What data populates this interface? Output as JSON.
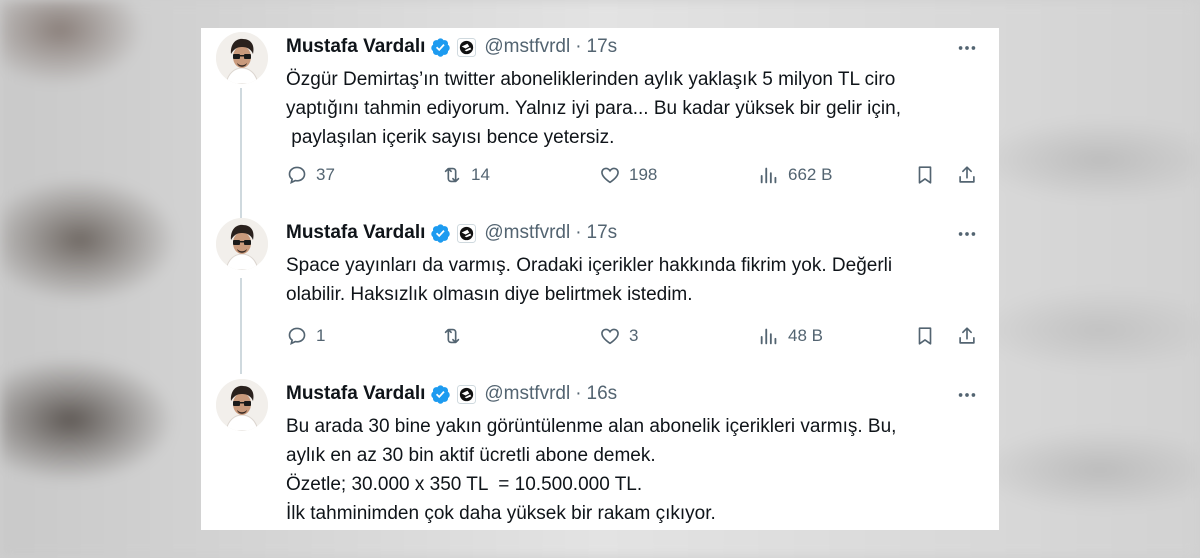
{
  "tweets": [
    {
      "author": {
        "name": "Mustafa Vardalı",
        "handle": "@mstfvrdl",
        "verified": true
      },
      "separator": "·",
      "time": "17s",
      "lines": [
        "Özgür Demirtaş’ın twitter aboneliklerinden aylık yaklaşık 5 milyon TL ciro",
        "yaptığını tahmin ediyorum. Yalnız iyi para... Bu kadar yüksek bir gelir için,",
        " paylaşılan içerik sayısı bence yetersiz."
      ],
      "stats": {
        "replies": "37",
        "reposts": "14",
        "likes": "198",
        "views": "662 B"
      }
    },
    {
      "author": {
        "name": "Mustafa Vardalı",
        "handle": "@mstfvrdl",
        "verified": true
      },
      "separator": "·",
      "time": "17s",
      "lines": [
        "Space yayınları da varmış. Oradaki içerikler hakkında fikrim yok. Değerli",
        "olabilir. Haksızlık olmasın diye belirtmek istedim."
      ],
      "stats": {
        "replies": "1",
        "reposts": "",
        "likes": "3",
        "views": "48 B"
      }
    },
    {
      "author": {
        "name": "Mustafa Vardalı",
        "handle": "@mstfvrdl",
        "verified": true
      },
      "separator": "·",
      "time": "16s",
      "lines": [
        "Bu arada 30 bine yakın görüntülenme alan abonelik içerikleri varmış. Bu,",
        "aylık en az 30 bin aktif ücretli abone demek.",
        "Özetle; 30.000 x 350 TL  = 10.500.000 TL.",
        "İlk tahminimden çok daha yüksek bir rakam çıkıyor."
      ]
    }
  ],
  "icons": {
    "reply": "reply-icon",
    "repost": "repost-icon",
    "like": "like-icon",
    "views": "views-icon",
    "bookmark": "bookmark-icon",
    "share": "share-icon",
    "more": "more-icon",
    "verified": "verified-badge-icon",
    "affiliation": "affiliation-icon"
  },
  "colors": {
    "text": "#0f1419",
    "secondary": "#536471",
    "verified": "#1d9bf0",
    "thread_line": "#cfd9de"
  }
}
